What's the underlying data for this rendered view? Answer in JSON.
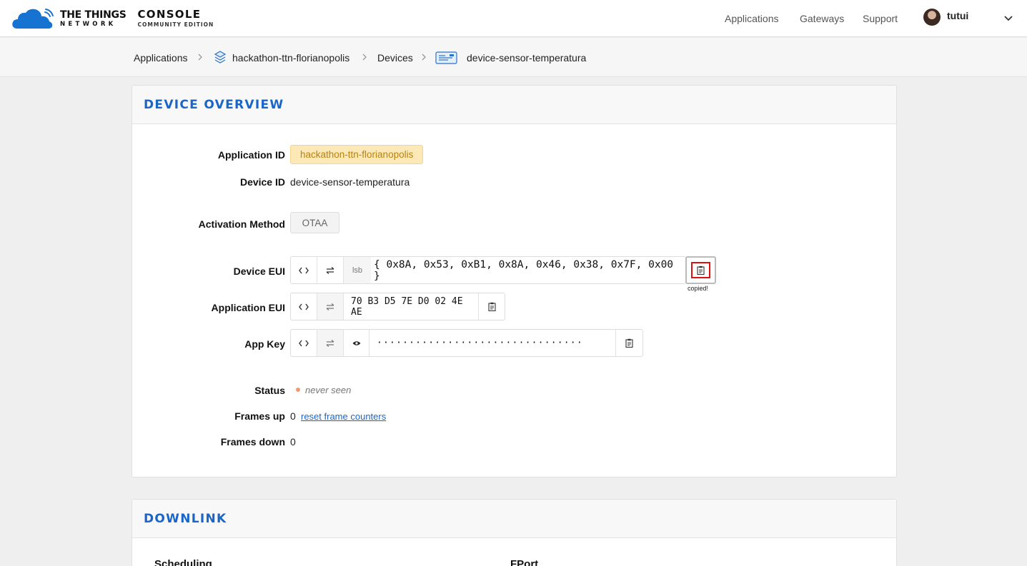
{
  "header": {
    "logo": {
      "line1": "THE THINGS",
      "line2": "NETWORK",
      "console": "CONSOLE",
      "edition": "COMMUNITY EDITION",
      "icon": "ttn-cloud-icon"
    },
    "nav": [
      "Applications",
      "Gateways",
      "Support"
    ],
    "user": {
      "name": "tutui"
    }
  },
  "breadcrumb": {
    "items": [
      "Applications",
      "hackathon-ttn-florianopolis",
      "Devices",
      "device-sensor-temperatura"
    ]
  },
  "overview": {
    "title": "DEVICE OVERVIEW",
    "application_id_label": "Application ID",
    "application_id": "hackathon-ttn-florianopolis",
    "device_id_label": "Device ID",
    "device_id": "device-sensor-temperatura",
    "activation_label": "Activation Method",
    "activation": "OTAA",
    "device_eui_label": "Device EUI",
    "device_eui_order": "lsb",
    "device_eui": "{ 0x8A, 0x53, 0xB1, 0x8A, 0x46, 0x38, 0x7F, 0x00 }",
    "copied": "copied!",
    "app_eui_label": "Application EUI",
    "app_eui": "70 B3 D5 7E D0 02 4E AE",
    "app_key_label": "App Key",
    "app_key": "································",
    "status_label": "Status",
    "status": "never seen",
    "frames_up_label": "Frames up",
    "frames_up": "0",
    "reset_link": "reset frame counters",
    "frames_down_label": "Frames down",
    "frames_down": "0",
    "status_color": "#f09a72",
    "accent_color": "#1a66c8"
  },
  "downlink": {
    "title": "DOWNLINK",
    "scheduling_label": "Scheduling",
    "fport_label": "FPort"
  }
}
